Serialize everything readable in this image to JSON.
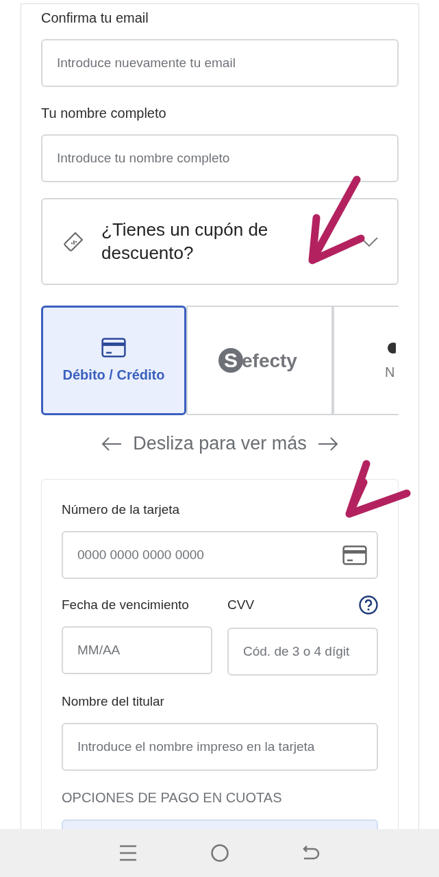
{
  "email_confirm": {
    "label": "Confirma tu email",
    "placeholder": "Introduce nuevamente tu email"
  },
  "full_name": {
    "label": "Tu nombre completo",
    "placeholder": "Introduce tu nombre completo"
  },
  "coupon": {
    "text": "¿Tienes un cupón de descuento?",
    "expanded": false
  },
  "payment_methods": [
    {
      "kind": "card",
      "label": "Débito / Crédito",
      "selected": true
    },
    {
      "kind": "logo",
      "logo_mark": "S",
      "logo_text": "efecty",
      "selected": false
    },
    {
      "kind": "partial",
      "label": "N",
      "selected": false
    }
  ],
  "swipe_hint": "Desliza para ver más",
  "card_form": {
    "number": {
      "label": "Número de la tarjeta",
      "placeholder": "0000 0000 0000 0000"
    },
    "expiry": {
      "label": "Fecha de vencimiento",
      "placeholder": "MM/AA"
    },
    "cvv": {
      "label": "CVV",
      "placeholder": "Cód. de 3 o 4 dígit"
    },
    "holder": {
      "label": "Nombre del titular",
      "placeholder": "Introduce el nombre impreso en la tarjeta"
    },
    "installments_heading": "OPCIONES DE PAGO EN CUOTAS"
  }
}
